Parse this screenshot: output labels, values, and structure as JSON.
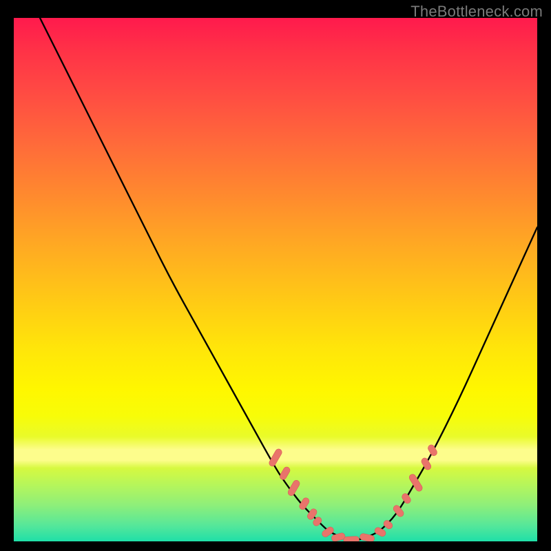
{
  "watermark": "TheBottleneck.com",
  "colors": {
    "curve_stroke": "#000000",
    "marker_fill": "#e9746b",
    "marker_stroke": "#d85e55"
  },
  "chart_data": {
    "type": "line",
    "title": "",
    "xlabel": "",
    "ylabel": "",
    "xlim": [
      0,
      100
    ],
    "ylim": [
      0,
      100
    ],
    "series": [
      {
        "name": "bottleneck-curve",
        "x": [
          5,
          10,
          15,
          20,
          25,
          30,
          35,
          40,
          45,
          50,
          52,
          55,
          58,
          60,
          62,
          65,
          68,
          70,
          73,
          76,
          80,
          85,
          90,
          95,
          100
        ],
        "y": [
          100,
          90,
          80,
          70,
          60,
          50,
          41,
          32,
          23,
          14,
          11,
          7,
          4,
          2,
          1,
          0,
          1,
          2,
          5,
          10,
          17,
          27,
          38,
          49,
          60
        ]
      }
    ],
    "markers": [
      {
        "x": 50.0,
        "y": 16.0,
        "len": 3.6,
        "angle_deg": 60
      },
      {
        "x": 51.8,
        "y": 13.0,
        "len": 2.6,
        "angle_deg": 60
      },
      {
        "x": 53.5,
        "y": 10.2,
        "len": 3.2,
        "angle_deg": 60
      },
      {
        "x": 55.5,
        "y": 7.2,
        "len": 2.4,
        "angle_deg": 58
      },
      {
        "x": 57.0,
        "y": 5.2,
        "len": 2.2,
        "angle_deg": 55
      },
      {
        "x": 58.0,
        "y": 3.8,
        "len": 1.8,
        "angle_deg": 50
      },
      {
        "x": 60.0,
        "y": 1.8,
        "len": 2.4,
        "angle_deg": 35
      },
      {
        "x": 62.0,
        "y": 0.8,
        "len": 2.6,
        "angle_deg": 15
      },
      {
        "x": 64.5,
        "y": 0.3,
        "len": 3.0,
        "angle_deg": 3
      },
      {
        "x": 67.5,
        "y": 0.7,
        "len": 2.8,
        "angle_deg": -12
      },
      {
        "x": 70.0,
        "y": 1.8,
        "len": 2.2,
        "angle_deg": -28
      },
      {
        "x": 71.5,
        "y": 3.2,
        "len": 1.8,
        "angle_deg": -40
      },
      {
        "x": 73.5,
        "y": 5.8,
        "len": 2.4,
        "angle_deg": -52
      },
      {
        "x": 75.0,
        "y": 8.2,
        "len": 2.0,
        "angle_deg": -56
      },
      {
        "x": 76.8,
        "y": 11.2,
        "len": 3.6,
        "angle_deg": -58
      },
      {
        "x": 78.8,
        "y": 14.8,
        "len": 2.4,
        "angle_deg": -60
      },
      {
        "x": 80.0,
        "y": 17.4,
        "len": 2.2,
        "angle_deg": -60
      }
    ]
  }
}
